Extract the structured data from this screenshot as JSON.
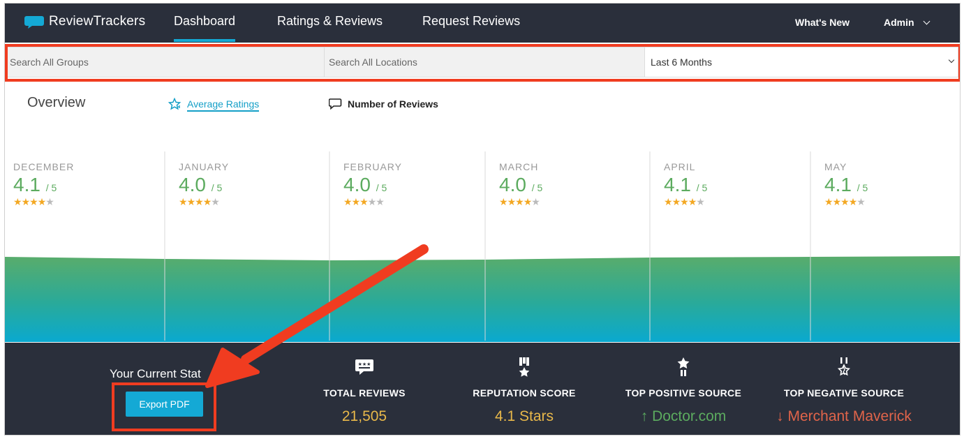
{
  "nav": {
    "logo_text_bold": "Review",
    "logo_text": "Trackers",
    "items": [
      {
        "label": "Dashboard",
        "active": true
      },
      {
        "label": "Ratings & Reviews",
        "active": false
      },
      {
        "label": "Request Reviews",
        "active": false
      }
    ],
    "whats_new": "What's New",
    "admin": "Admin"
  },
  "filters": {
    "groups_placeholder": "Search All Groups",
    "locations_placeholder": "Search All Locations",
    "period_selected": "Last 6 Months"
  },
  "overview": {
    "title": "Overview",
    "tab_average": "Average Ratings",
    "tab_reviews": "Number of Reviews"
  },
  "months": [
    {
      "name": "DECEMBER",
      "rating": "4.1",
      "out": "/ 5",
      "stars_on": 4
    },
    {
      "name": "JANUARY",
      "rating": "4.0",
      "out": "/ 5",
      "stars_on": 4
    },
    {
      "name": "FEBRUARY",
      "rating": "4.0",
      "out": "/ 5",
      "stars_on": 3
    },
    {
      "name": "MARCH",
      "rating": "4.0",
      "out": "/ 5",
      "stars_on": 4
    },
    {
      "name": "APRIL",
      "rating": "4.1",
      "out": "/ 5",
      "stars_on": 4
    },
    {
      "name": "MAY",
      "rating": "4.1",
      "out": "/ 5",
      "stars_on": 4
    }
  ],
  "stats": {
    "title": "Your Current Stat",
    "export_label": "Export PDF",
    "total_reviews_label": "TOTAL REVIEWS",
    "total_reviews_value": "21,505",
    "reputation_label": "REPUTATION SCORE",
    "reputation_value": "4.1 Stars",
    "top_positive_label": "TOP POSITIVE SOURCE",
    "top_positive_value": "Doctor.com",
    "top_negative_label": "TOP NEGATIVE SOURCE",
    "top_negative_value": "Merchant Maverick"
  },
  "colors": {
    "nav_bg": "#2a2f3b",
    "accent": "#14a9d5",
    "green": "#5cab5f",
    "star": "#f3a823",
    "value_gold": "#e8b84a",
    "positive": "#5cab5f",
    "negative": "#e0644a",
    "highlight": "#f03c20"
  }
}
